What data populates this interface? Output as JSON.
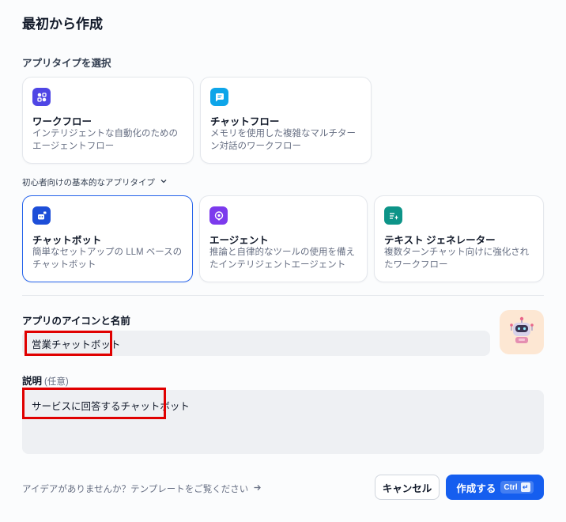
{
  "header": {
    "title": "最初から作成"
  },
  "app_type_section": {
    "label": "アプリタイプを選択"
  },
  "primary_types": [
    {
      "name": "ワークフロー",
      "desc": "インテリジェントな自動化のためのエージェントフロー",
      "icon": "workflow-icon"
    },
    {
      "name": "チャットフロー",
      "desc": "メモリを使用した複雑なマルチターン対話のワークフロー",
      "icon": "chatflow-icon"
    }
  ],
  "beginner_section": {
    "label": "初心者向けの基本的なアプリタイプ",
    "icon": "chevron-down-icon"
  },
  "basic_types": [
    {
      "name": "チャットボット",
      "desc": "簡単なセットアップの LLM ベースのチャットボット",
      "icon": "chatbot-icon",
      "selected": true
    },
    {
      "name": "エージェント",
      "desc": "推論と自律的なツールの使用を備えたインテリジェントエージェント",
      "icon": "agent-icon",
      "selected": false
    },
    {
      "name": "テキスト ジェネレーター",
      "desc": "複数ターンチャット向けに強化されたワークフロー",
      "icon": "text-generator-icon",
      "selected": false
    }
  ],
  "name_field": {
    "label": "アプリのアイコンと名前",
    "value": "営業チャットボット",
    "avatar_icon": "robot-icon"
  },
  "description_field": {
    "label": "説明",
    "optional": "(任意)",
    "value": "サービスに回答するチャットボット"
  },
  "footer": {
    "template_link": "アイデアがありませんか？テンプレートをご覧ください",
    "template_icon": "arrow-right-icon",
    "cancel_label": "キャンセル",
    "create_label": "作成する",
    "shortcut": "Ctrl",
    "shortcut_icon": "enter-icon"
  },
  "colors": {
    "accent": "#155eef",
    "highlight": "#e00000",
    "selected_border": "#2563eb"
  }
}
